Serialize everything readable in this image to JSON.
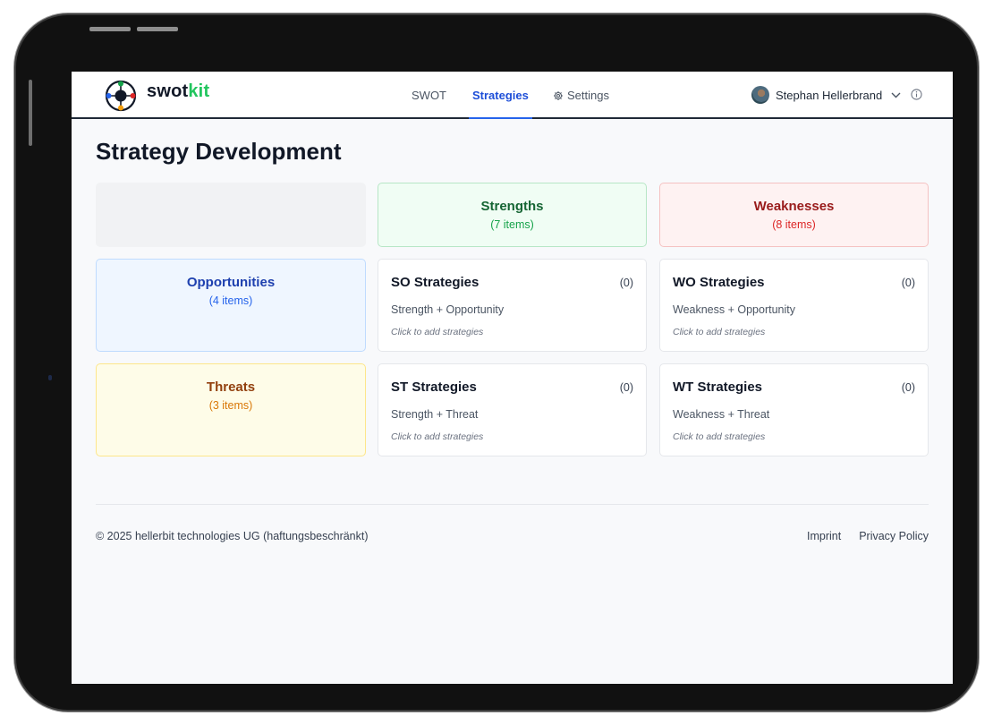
{
  "app": {
    "brand_part1": "swot",
    "brand_part2": "kit",
    "accent_color": "#2563eb",
    "brand_color": "#22c55e"
  },
  "nav": {
    "items": [
      {
        "label": "SWOT"
      },
      {
        "label": "Strategies",
        "active": true
      },
      {
        "label": "Settings",
        "icon": "gear-icon"
      }
    ]
  },
  "user": {
    "name": "Stephan Hellerbrand"
  },
  "page": {
    "title": "Strategy Development"
  },
  "matrix": {
    "strengths": {
      "label": "Strengths",
      "count": "(7 items)",
      "color": "#166534"
    },
    "weaknesses": {
      "label": "Weaknesses",
      "count": "(8 items)",
      "color": "#991b1b"
    },
    "opportunities": {
      "label": "Opportunities",
      "count": "(4 items)",
      "color": "#1e40af"
    },
    "threats": {
      "label": "Threats",
      "count": "(3 items)",
      "color": "#92400e"
    },
    "strategies": [
      {
        "title": "SO Strategies",
        "count": "(0)",
        "description": "Strength + Opportunity",
        "hint": "Click to add strategies"
      },
      {
        "title": "WO Strategies",
        "count": "(0)",
        "description": "Weakness + Opportunity",
        "hint": "Click to add strategies"
      },
      {
        "title": "ST Strategies",
        "count": "(0)",
        "description": "Strength + Threat",
        "hint": "Click to add strategies"
      },
      {
        "title": "WT Strategies",
        "count": "(0)",
        "description": "Weakness + Threat",
        "hint": "Click to add strategies"
      }
    ]
  },
  "footer": {
    "copyright": "© 2025 hellerbit technologies UG (haftungsbeschränkt)",
    "links": [
      {
        "label": "Imprint"
      },
      {
        "label": "Privacy Policy"
      }
    ]
  }
}
